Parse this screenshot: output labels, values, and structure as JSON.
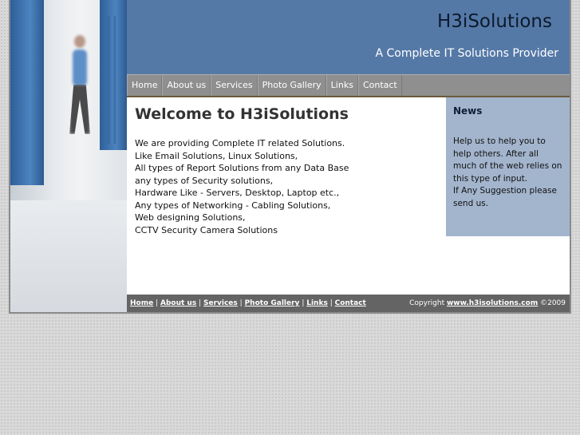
{
  "header": {
    "site_title": "H3iSolutions",
    "tagline": "A Complete IT Solutions Provider"
  },
  "nav": {
    "items": [
      "Home",
      "About us",
      "Services",
      "Photo Gallery",
      "Links",
      "Contact"
    ]
  },
  "main": {
    "heading": "Welcome to H3iSolutions",
    "lines": [
      "We are providing Complete IT related Solutions.",
      "Like Email Solutions, Linux Solutions,",
      "All types of Report Solutions from any Data Base",
      "any types of Security solutions,",
      "Hardware Like - Servers, Desktop, Laptop etc.,",
      "Any types of Networking - Cabling Solutions,",
      "Web designing Solutions,",
      "CCTV Security Camera Solutions"
    ]
  },
  "news": {
    "title": "News",
    "text_1": "Help us to help you to help others. After all much of the web relies on this type of input.",
    "text_2": "If Any Suggestion please send us."
  },
  "footer": {
    "links": [
      "Home",
      "About us",
      "Services",
      "Photo Gallery",
      "Links",
      "Contact"
    ],
    "separator": "|",
    "copyright_prefix": "Copyright",
    "copyright_link": "www.h3isolutions.com",
    "copyright_suffix": "©2009"
  },
  "colors": {
    "header_bg": "#5579a7",
    "nav_bg": "#8f8f8f",
    "news_bg": "#a3b5cd",
    "footer_bg": "#646464"
  }
}
